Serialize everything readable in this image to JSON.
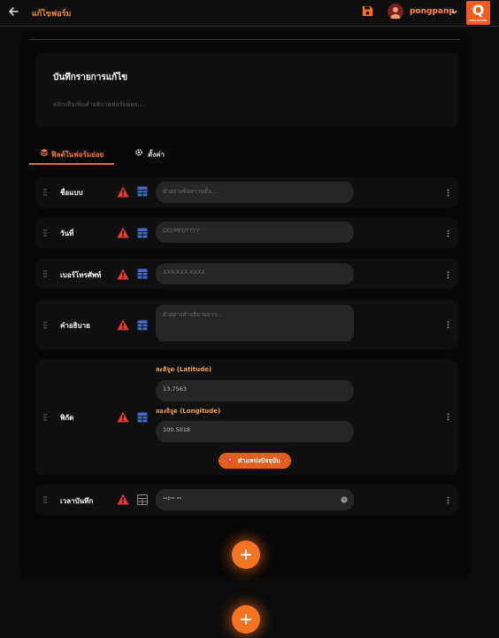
{
  "header": {
    "title": "แก้ไขฟอร์ม",
    "username": "pongpanp",
    "logo_letter": "Q",
    "logo_sub": "COLLECTOR"
  },
  "form": {
    "title": "บันทึกรายการแก้ไข",
    "description_placeholder": "คลิกเพื่อเพิ่มคำอธิบายฟอร์มย่อย..."
  },
  "tabs": [
    {
      "label": "ฟิลด์ในฟอร์มย่อย",
      "active": true
    },
    {
      "label": "ตั้งค่า",
      "active": false
    }
  ],
  "fields": {
    "name": {
      "label": "ชื่อแบบ",
      "placeholder": "ตัวอย่างข้อความสั้น..."
    },
    "date": {
      "label": "วันที่",
      "placeholder": "DD/MM/YYYY"
    },
    "phone": {
      "label": "เบอร์โทรศัพท์",
      "placeholder": "XXX-XXX-XXXX"
    },
    "desc": {
      "label": "คำอธิบาย",
      "placeholder": "ตัวอย่างคำอธิบายยาว..."
    },
    "coord": {
      "label": "พิกัด",
      "lat_label": "ละติจูด (Latitude)",
      "lat_value": "13.7563",
      "lng_label": "ลองจิจูด (Longitude)",
      "lng_value": "100.5018",
      "location_button": "ตำแหน่งปัจจุบัน"
    },
    "time": {
      "label": "เวลาบันทึก",
      "value": "--:-- --"
    }
  },
  "colors": {
    "accent": "#f27321",
    "warning": "#e53935",
    "grid_icon": "#3b6fd6",
    "background": "#0c0c0c"
  }
}
